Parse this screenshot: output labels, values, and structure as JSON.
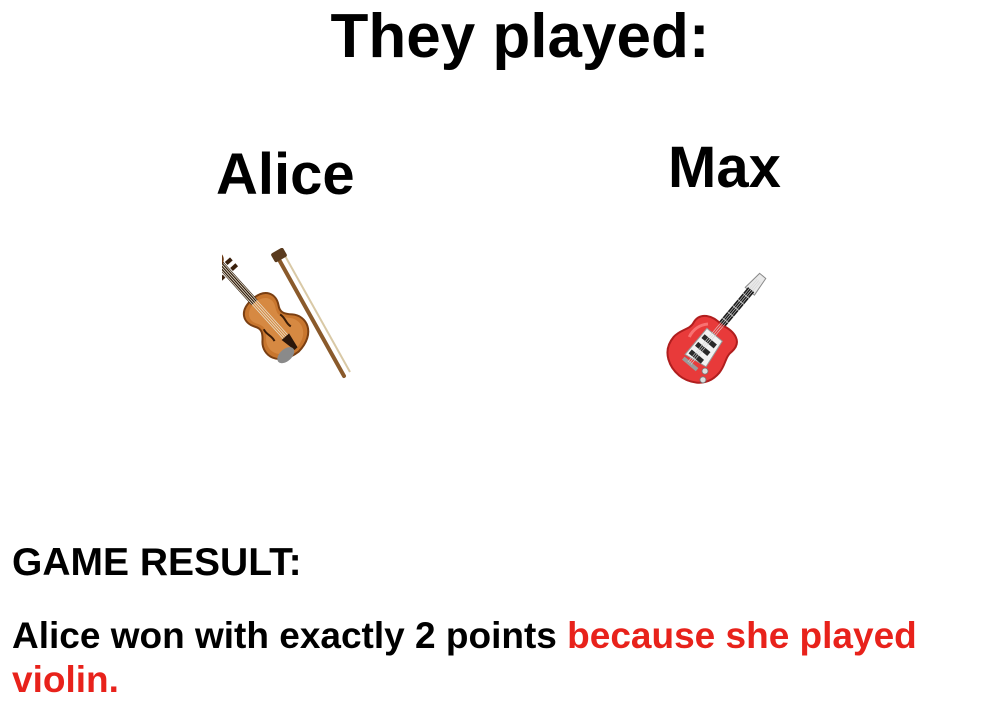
{
  "title": "They played:",
  "players": [
    {
      "name": "Alice",
      "instrument_icon": "violin-icon"
    },
    {
      "name": "Max",
      "instrument_icon": "electric-guitar-icon"
    }
  ],
  "result": {
    "heading": "GAME RESULT:",
    "text_plain": "Alice won with exactly 2 points ",
    "text_highlight": "because she played violin."
  },
  "colors": {
    "highlight": "#e8221b",
    "text": "#000000",
    "background": "#ffffff"
  }
}
